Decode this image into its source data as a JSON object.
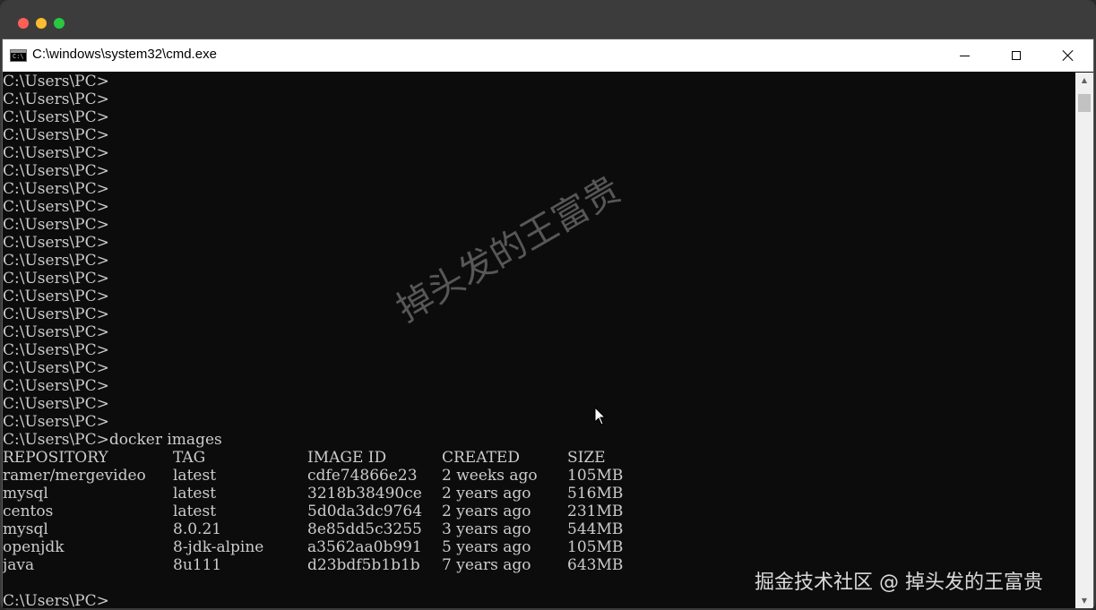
{
  "window": {
    "title": "C:\\windows\\system32\\cmd.exe",
    "icon": "cmd-icon",
    "icon_text": "C:\\"
  },
  "controls": {
    "minimize": "minimize-icon",
    "maximize": "maximize-icon",
    "close": "close-icon"
  },
  "console": {
    "prompt_lines": [
      "C:\\Users\\PC>",
      "C:\\Users\\PC>",
      "C:\\Users\\PC>",
      "C:\\Users\\PC>",
      "C:\\Users\\PC>",
      "C:\\Users\\PC>",
      "C:\\Users\\PC>",
      "C:\\Users\\PC>",
      "C:\\Users\\PC>",
      "C:\\Users\\PC>",
      "C:\\Users\\PC>",
      "C:\\Users\\PC>",
      "C:\\Users\\PC>",
      "C:\\Users\\PC>",
      "C:\\Users\\PC>",
      "C:\\Users\\PC>",
      "C:\\Users\\PC>",
      "C:\\Users\\PC>",
      "C:\\Users\\PC>",
      "C:\\Users\\PC>"
    ],
    "command_line": "C:\\Users\\PC>docker images",
    "table": {
      "headers": [
        "REPOSITORY",
        "TAG",
        "IMAGE ID",
        "CREATED",
        "SIZE"
      ],
      "rows": [
        [
          "ramer/mergevideo",
          "latest",
          "cdfe74866e23",
          "2 weeks ago",
          "105MB"
        ],
        [
          "mysql",
          "latest",
          "3218b38490ce",
          "2 years ago",
          "516MB"
        ],
        [
          "centos",
          "latest",
          "5d0da3dc9764",
          "2 years ago",
          "231MB"
        ],
        [
          "mysql",
          "8.0.21",
          "8e85dd5c3255",
          "3 years ago",
          "544MB"
        ],
        [
          "openjdk",
          "8-jdk-alpine",
          "a3562aa0b991",
          "5 years ago",
          "105MB"
        ],
        [
          "java",
          "8u111",
          "d23bdf5b1b1b",
          "7 years ago",
          "643MB"
        ]
      ]
    },
    "final_prompt": "C:\\Users\\PC>"
  },
  "watermarks": {
    "center": "掉头发的王富贵",
    "corner": "掘金技术社区 @ 掉头发的王富贵"
  },
  "colors": {
    "console_bg": "#0c0c0c",
    "console_text": "#cccccc",
    "mac_red": "#ff5f57",
    "mac_yellow": "#febc2e",
    "mac_green": "#28c840"
  }
}
